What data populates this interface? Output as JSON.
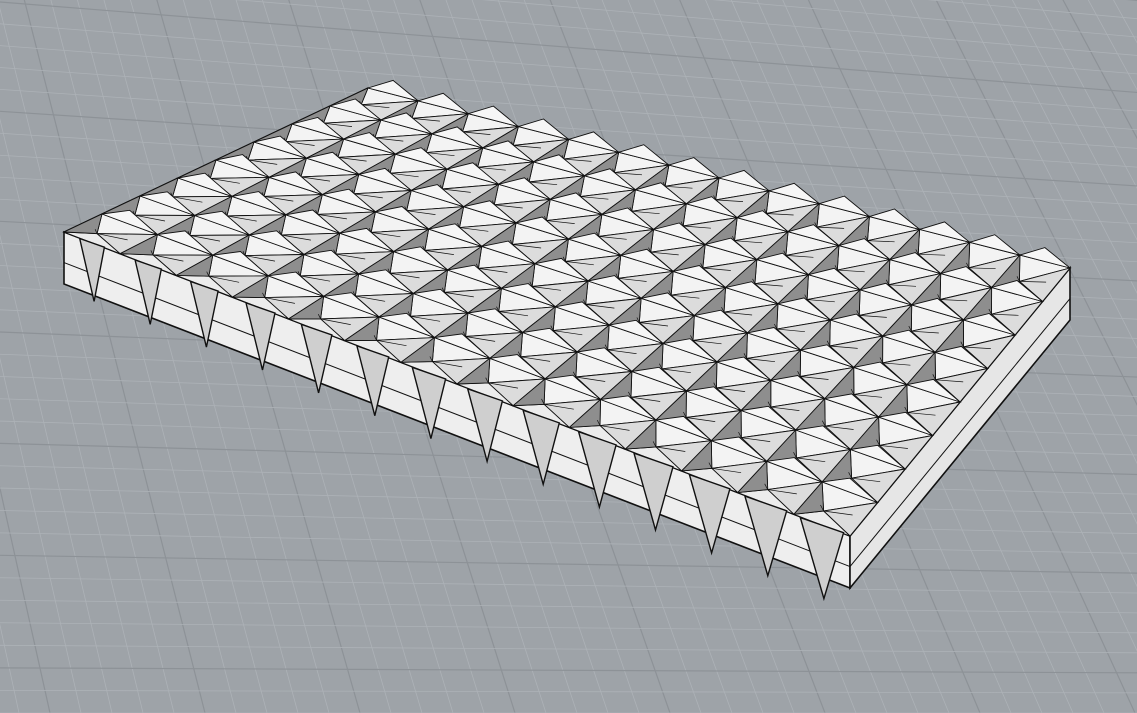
{
  "viewport": {
    "background_color": "#9ea3a8",
    "grid_minor_color": "#adb2b7",
    "grid_major_color": "#8d9297",
    "view_type": "perspective",
    "display_mode": "shaded-with-edges"
  },
  "model": {
    "object_type": "folded-panel-slab",
    "face_top_color": "#ececec",
    "face_front_color": "#eeeeee",
    "face_side_color": "#e6e6e6",
    "edge_color": "#111111",
    "shadow_face_color": "#8e8e8e",
    "pattern_rows": 8,
    "pattern_columns": 14
  }
}
